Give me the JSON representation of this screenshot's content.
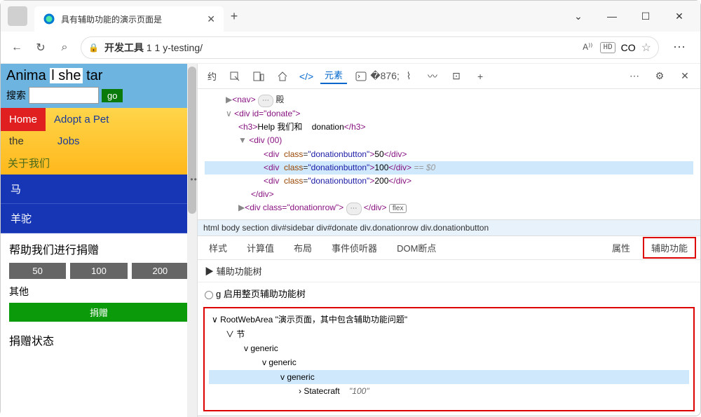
{
  "window": {
    "tab_title": "具有辅助功能的演示页面是",
    "minimize": "—",
    "maximize": "☐",
    "close": "✕"
  },
  "addressbar": {
    "back": "←",
    "refresh": "↻",
    "search_icon": "⌕",
    "lock": "🔒",
    "url_bold": "开发工具",
    "url_rest": " 1 1 y-testing/",
    "read_aloud": "A⁾⁾",
    "hd": "HD",
    "profile": "CO",
    "favorite": "☆",
    "menu": "⋯"
  },
  "webpage": {
    "title_a": "Anima",
    "title_b": "l she",
    "title_c": "tar",
    "search_label": "搜索",
    "go": "go",
    "nav": {
      "home": "Home",
      "adopt": "Adopt a Pet",
      "the": "the",
      "jobs": "Jobs"
    },
    "about": "关于我们",
    "side1": "马",
    "side2": "羊驼",
    "donate_title": "帮助我们进行捐赠",
    "amounts": [
      "50",
      "100",
      "200"
    ],
    "other": "其他",
    "donate_btn": "捐赠",
    "status_title": "捐赠状态"
  },
  "devtools": {
    "toolbar": {
      "welcome": "约",
      "elements": "元素",
      "plus": "+",
      "more": "⋯",
      "settings": "⚙",
      "close": "✕"
    },
    "dom": {
      "l1_pre": "▶",
      "l1_tag": "nav",
      "l1_badge": "⋯",
      "l1_txt": "殿",
      "l2_pre": "∨",
      "l2_open": "<div id=\"donate\">",
      "l3_tag_open": "<h3>",
      "l3_txt1": "Help 我们和",
      "l3_txt2": "donation",
      "l3_tag_close": "</h3>",
      "l4_pre": "▼",
      "l4_txt": "<div (00)",
      "btn_open": "<div",
      "btn_class_k": "class",
      "btn_class_v": "\"donationbutton\"",
      "btn_close": "</div>",
      "v50": "50",
      "v100": "100",
      "v200": "200",
      "hint": "== $0",
      "row_pre": "▶",
      "row_open": "<div class=\"donationrow\">",
      "row_badge": "⋯",
      "row_close": "</div>",
      "flex": "flex"
    },
    "breadcrumb": "html body section div#sidebar div#donate div.donationrow div.donationbutton",
    "subtabs": {
      "styles": "样式",
      "computed": "计算值",
      "layout": "布局",
      "listeners": "事件侦听器",
      "dom_bp": "DOM断点",
      "props": "属性",
      "a11y": "辅助功能"
    },
    "a11y": {
      "header": "▶ 辅助功能树",
      "option": "g 启用整页辅助功能树",
      "root_pre": "∨ RootWebArea",
      "root_title": "\"演示页面，其中包含辅助功能问题\"",
      "sect": "∨ 节",
      "gen": "v generic",
      "leaf_pre": "› Statecraft",
      "leaf_val": "\"100\""
    }
  }
}
